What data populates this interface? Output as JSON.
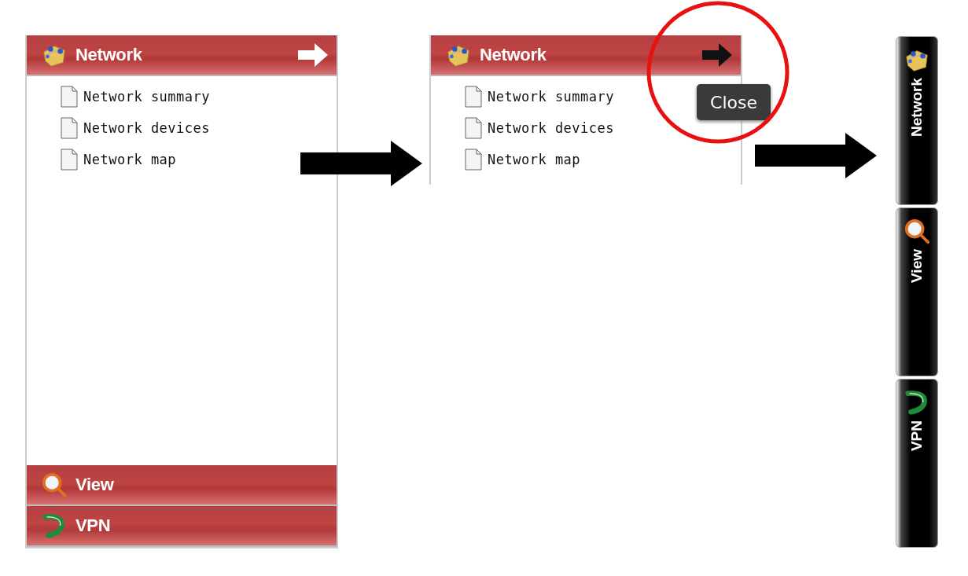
{
  "panels": [
    {
      "kind": "accordion",
      "close_hovered": false,
      "sections": [
        {
          "label": "Network",
          "items": [
            "Network summary",
            "Network devices",
            "Network map"
          ]
        },
        {
          "label": "View"
        },
        {
          "label": "VPN"
        }
      ]
    },
    {
      "kind": "cropped",
      "close_hovered": true,
      "tooltip": "Close",
      "sections": [
        {
          "label": "Network",
          "items": [
            "Network summary",
            "Network devices",
            "Network map"
          ]
        }
      ]
    },
    {
      "kind": "collapsed",
      "tabs": [
        {
          "label": "Network"
        },
        {
          "label": "View"
        },
        {
          "label": "VPN"
        }
      ]
    }
  ]
}
